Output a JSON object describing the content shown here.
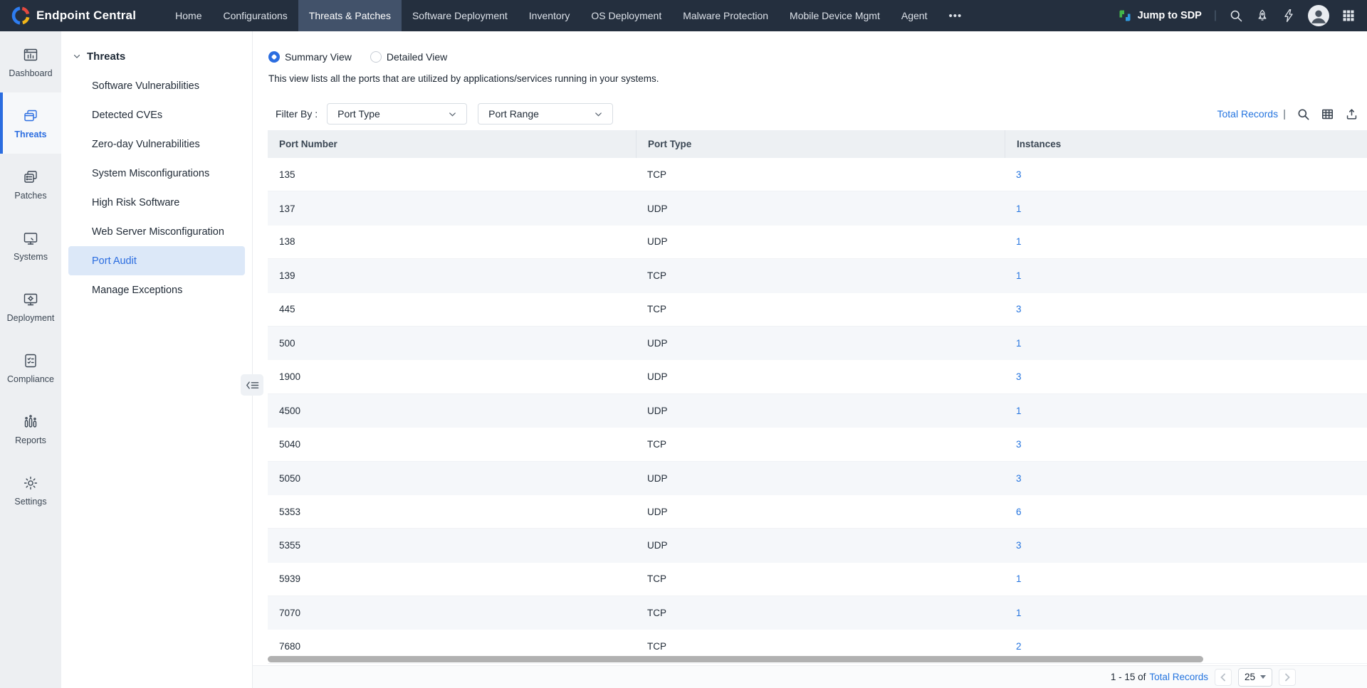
{
  "colors": {
    "accent": "#2b6de0",
    "link": "#2474df",
    "navbar_bg": "#242f3e",
    "navbar_active_bg": "#42526a"
  },
  "navbar": {
    "brand": "Endpoint Central",
    "brand_icon": "endpoint-central-logo",
    "items": [
      {
        "label": "Home",
        "active": false
      },
      {
        "label": "Configurations",
        "active": false
      },
      {
        "label": "Threats & Patches",
        "active": true
      },
      {
        "label": "Software Deployment",
        "active": false
      },
      {
        "label": "Inventory",
        "active": false
      },
      {
        "label": "OS Deployment",
        "active": false
      },
      {
        "label": "Malware Protection",
        "active": false
      },
      {
        "label": "Mobile Device Mgmt",
        "active": false
      },
      {
        "label": "Agent",
        "active": false
      },
      {
        "label": "•••",
        "active": false
      }
    ],
    "jump_to_sdp": "Jump to SDP",
    "separator": "|",
    "right_icons": [
      "sdp-logo-icon",
      "search-icon",
      "rocket-icon",
      "lightning-icon",
      "avatar",
      "apps-grid-icon"
    ]
  },
  "sidebar": {
    "items": [
      {
        "label": "Dashboard",
        "icon": "dashboard-icon",
        "active": false
      },
      {
        "label": "Threats",
        "icon": "threats-icon",
        "active": true
      },
      {
        "label": "Patches",
        "icon": "patches-icon",
        "active": false
      },
      {
        "label": "Systems",
        "icon": "systems-icon",
        "active": false
      },
      {
        "label": "Deployment",
        "icon": "deployment-icon",
        "active": false
      },
      {
        "label": "Compliance",
        "icon": "compliance-icon",
        "active": false
      },
      {
        "label": "Reports",
        "icon": "reports-icon",
        "active": false
      },
      {
        "label": "Settings",
        "icon": "settings-icon",
        "active": false
      }
    ]
  },
  "subnav": {
    "title": "Threats",
    "items": [
      {
        "label": "Software Vulnerabilities",
        "active": false
      },
      {
        "label": "Detected CVEs",
        "active": false
      },
      {
        "label": "Zero-day Vulnerabilities",
        "active": false
      },
      {
        "label": "System Misconfigurations",
        "active": false
      },
      {
        "label": "High Risk Software",
        "active": false
      },
      {
        "label": "Web Server Misconfiguration",
        "active": false
      },
      {
        "label": "Port Audit",
        "active": true
      },
      {
        "label": "Manage Exceptions",
        "active": false
      }
    ]
  },
  "main": {
    "view_options": [
      {
        "label": "Summary View",
        "selected": true
      },
      {
        "label": "Detailed View",
        "selected": false
      }
    ],
    "description": "This view lists all the ports that are utilized by applications/services running in your systems.",
    "filter": {
      "label": "Filter By :",
      "dropdowns": [
        "Port Type",
        "Port Range"
      ]
    },
    "tools": {
      "total_records": "Total Records",
      "separator": "|",
      "icons": [
        "search-icon",
        "table-view-icon",
        "export-icon"
      ]
    },
    "table": {
      "columns": [
        "Port Number",
        "Port Type",
        "Instances"
      ],
      "rows": [
        [
          "135",
          "TCP",
          "3"
        ],
        [
          "137",
          "UDP",
          "1"
        ],
        [
          "138",
          "UDP",
          "1"
        ],
        [
          "139",
          "TCP",
          "1"
        ],
        [
          "445",
          "TCP",
          "3"
        ],
        [
          "500",
          "UDP",
          "1"
        ],
        [
          "1900",
          "UDP",
          "3"
        ],
        [
          "4500",
          "UDP",
          "1"
        ],
        [
          "5040",
          "TCP",
          "3"
        ],
        [
          "5050",
          "UDP",
          "3"
        ],
        [
          "5353",
          "UDP",
          "6"
        ],
        [
          "5355",
          "UDP",
          "3"
        ],
        [
          "5939",
          "TCP",
          "1"
        ],
        [
          "7070",
          "TCP",
          "1"
        ],
        [
          "7680",
          "TCP",
          "2"
        ]
      ]
    },
    "pagination": {
      "range": "1 - 15 of",
      "total_link": "Total Records",
      "page_size": "25"
    }
  }
}
